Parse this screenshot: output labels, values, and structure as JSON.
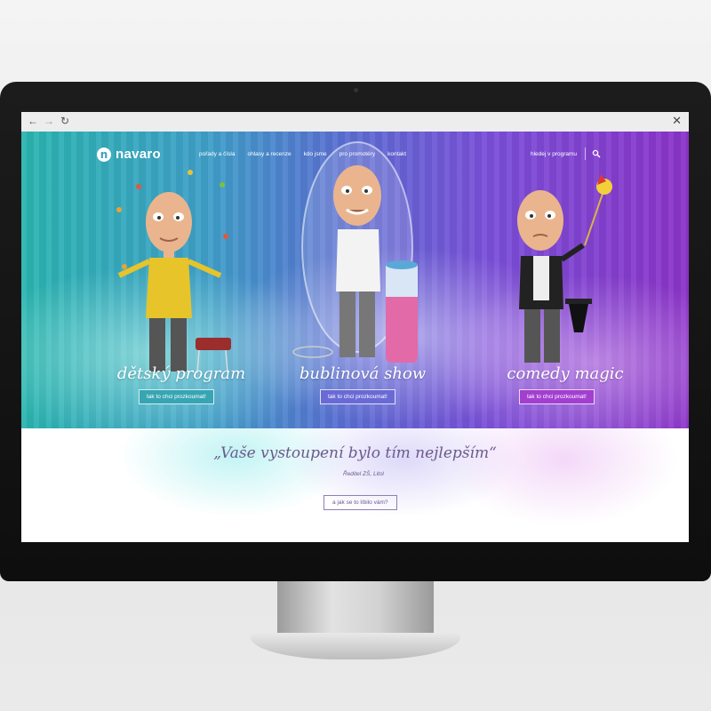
{
  "header": {
    "logo_mark": "n",
    "logo_text": "navaro",
    "nav": [
      "pořady a čísla",
      "ohlasy a recenze",
      "kdo jsme",
      "pro promotéry",
      "kontakt"
    ],
    "search_label": "hledej v programu"
  },
  "acts": [
    {
      "title": "dětský program",
      "button": "tak to chci prozkoumat!",
      "button_color": "#37a5b3"
    },
    {
      "title": "bublinová show",
      "button": "tak to chci prozkoumat!",
      "button_color": "#6a6ad6"
    },
    {
      "title": "comedy magic",
      "button": "tak to chci prozkoumat!",
      "button_color": "#a23fd0"
    }
  ],
  "testimonial": {
    "quote": "„Vaše vystoupení bylo tím nejlepším“",
    "author": "Ředitel ZŠ, Litol",
    "button": "a jak se to líbilo vám?"
  },
  "browser": {
    "back_icon": "arrow-left-icon",
    "forward_icon": "arrow-right-icon",
    "reload_icon": "reload-icon",
    "close_icon": "close-icon"
  },
  "colors": {
    "teal": "#2bb5b0",
    "blue": "#5a6fd2",
    "purple": "#8b34c9",
    "quote_text": "#6b5a8c"
  }
}
